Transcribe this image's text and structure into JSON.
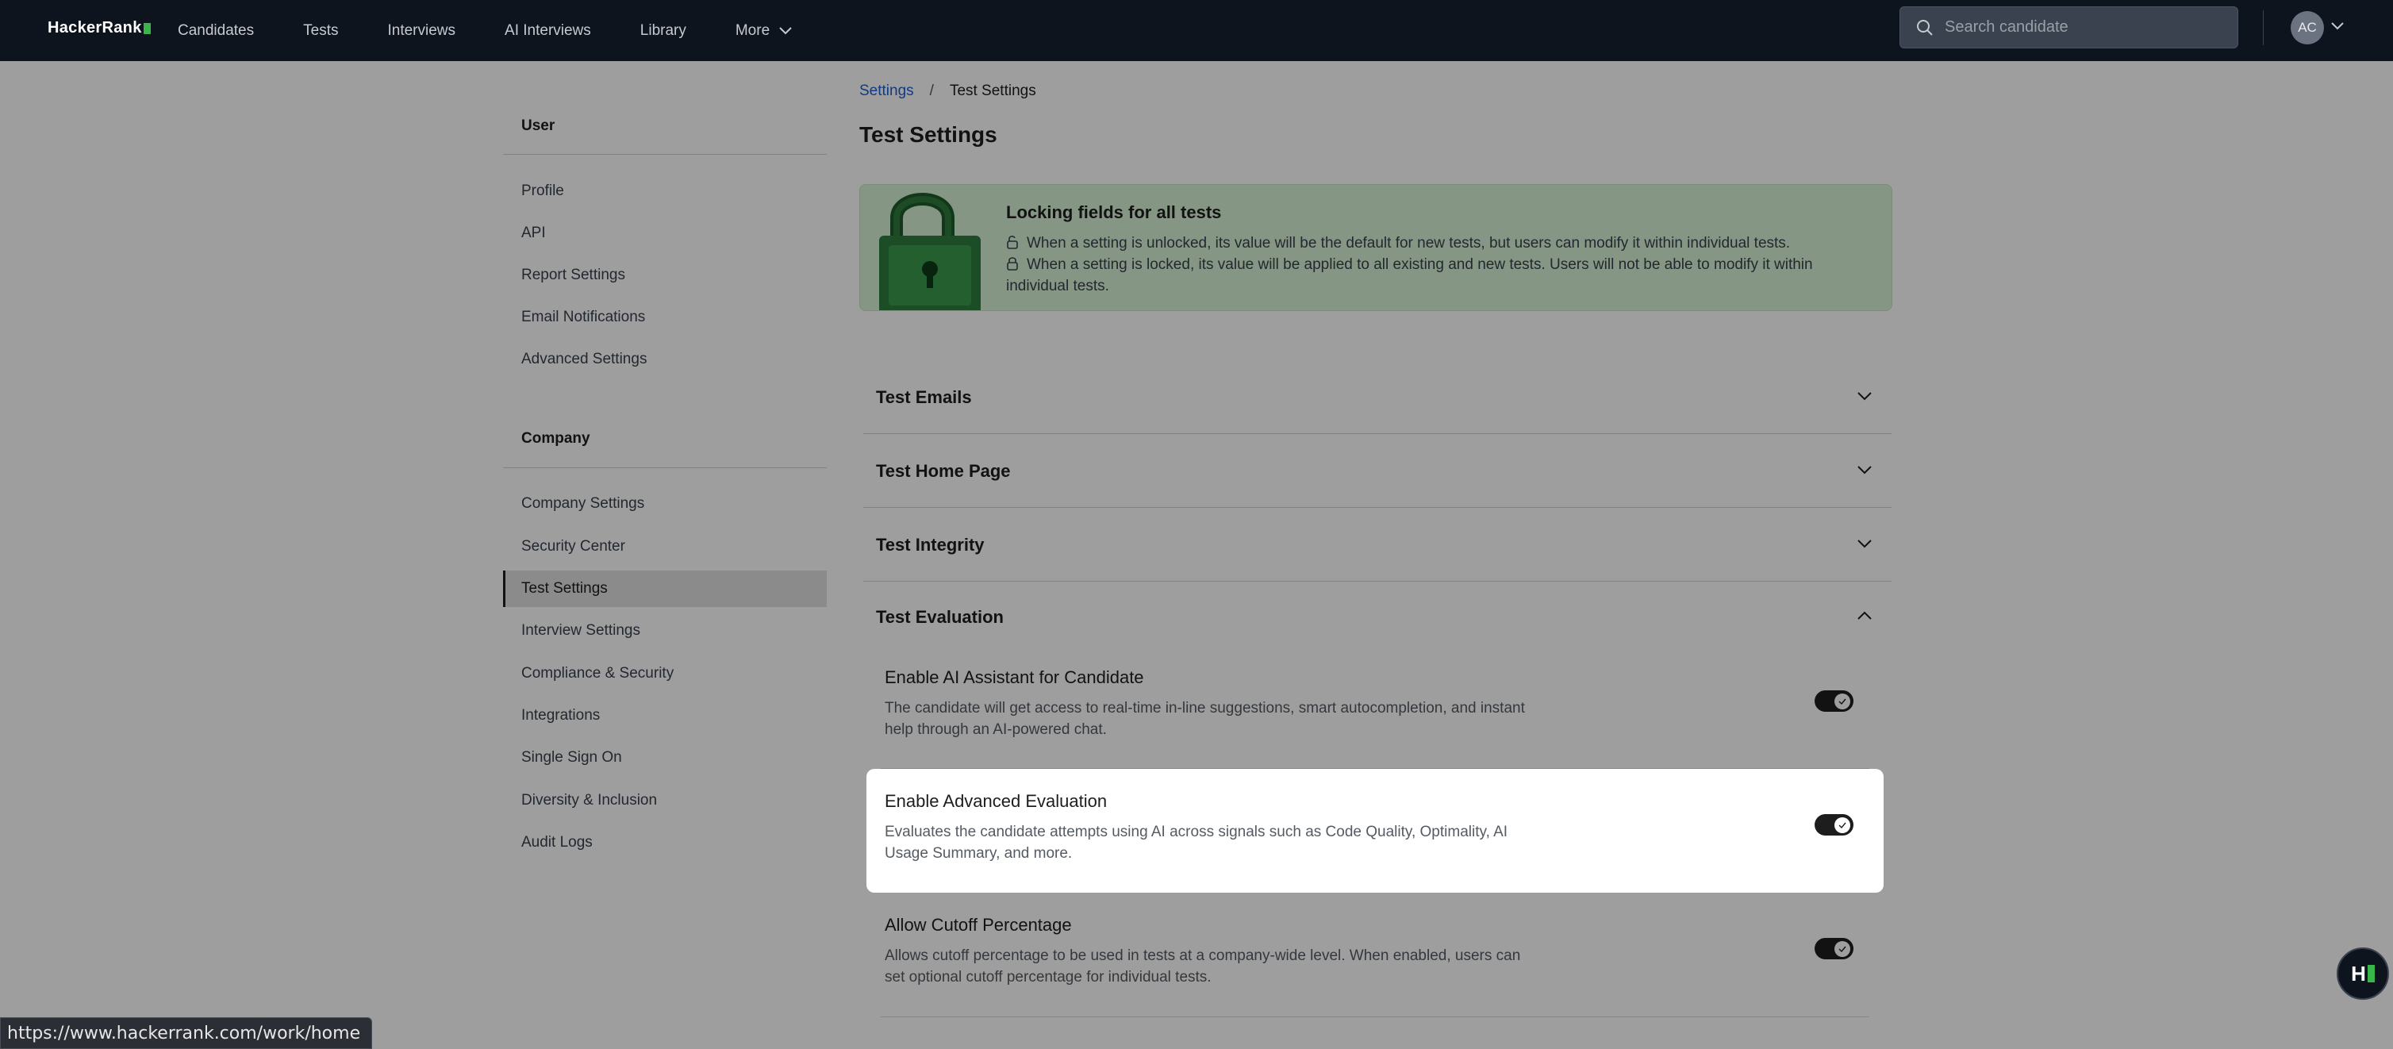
{
  "nav": {
    "logo_text": "HackerRank",
    "links": [
      "Candidates",
      "Tests",
      "Interviews",
      "AI Interviews",
      "Library",
      "More"
    ],
    "search_placeholder": "Search candidate",
    "avatar_initials": "AC"
  },
  "sidebar": {
    "user_heading": "User",
    "user_items": [
      "Profile",
      "API",
      "Report Settings",
      "Email Notifications",
      "Advanced Settings"
    ],
    "company_heading": "Company",
    "company_items": [
      "Company Settings",
      "Security Center",
      "Test Settings",
      "Interview Settings",
      "Compliance & Security",
      "Integrations",
      "Single Sign On",
      "Diversity & Inclusion",
      "Audit Logs"
    ],
    "active_item": "Test Settings"
  },
  "breadcrumb": {
    "parent": "Settings",
    "separator": "/",
    "current": "Test Settings"
  },
  "page_title": "Test Settings",
  "banner": {
    "title": "Locking fields for all tests",
    "unlocked_text": "When a setting is unlocked, its value will be the default for new tests, but users can modify it within individual tests.",
    "locked_text": "When a setting is locked, its value will be applied to all existing and new tests. Users will not be able to modify it within individual tests."
  },
  "sections": [
    {
      "title": "Test Emails",
      "expanded": false
    },
    {
      "title": "Test Home Page",
      "expanded": false
    },
    {
      "title": "Test Integrity",
      "expanded": false
    },
    {
      "title": "Test Evaluation",
      "expanded": true
    }
  ],
  "settings": [
    {
      "title": "Enable AI Assistant for Candidate",
      "description": "The candidate will get access to real-time in-line suggestions, smart autocompletion, and instant help through an AI-powered chat.",
      "enabled": true
    },
    {
      "title": "Enable Advanced Evaluation",
      "description": "Evaluates the candidate attempts using AI across signals such as Code Quality, Optimality, AI Usage Summary, and more.",
      "enabled": true
    },
    {
      "title": "Allow Cutoff Percentage",
      "description": "Allows cutoff percentage to be used in tests at a company-wide level. When enabled, users can set optional cutoff percentage for individual tests.",
      "enabled": true
    }
  ],
  "status_url": "https://www.hackerrank.com/work/home",
  "colors": {
    "nav_bg": "#0e141e",
    "brand_green": "#39b54a",
    "banner_bg": "#d8f2d5",
    "link_blue": "#1a5fd6"
  }
}
